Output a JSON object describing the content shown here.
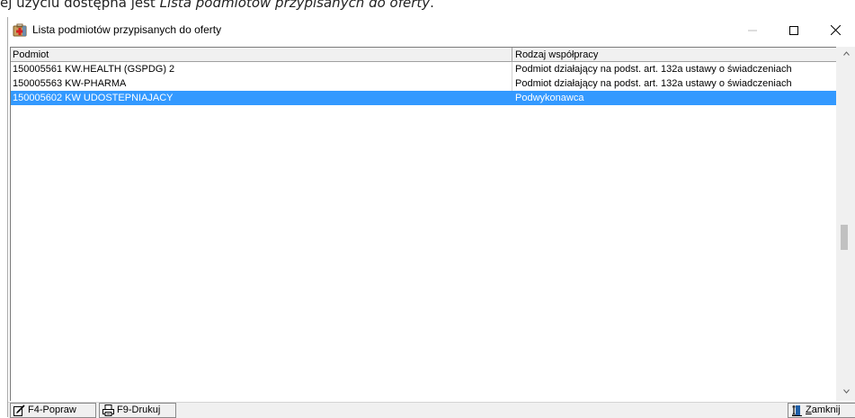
{
  "document": {
    "prefix": "ej użyciu dostępna jest ",
    "italic": "Lista podmiotów przypisanych do oferty",
    "suffix": "."
  },
  "window": {
    "title": "Lista podmiotów przypisanych do oferty"
  },
  "table": {
    "columns": [
      "Podmiot",
      "Rodzaj współpracy"
    ],
    "rows": [
      {
        "podmiot": "150005561 KW.HEALTH (GSPDG) 2",
        "rodzaj": "Podmiot działający na podst. art. 132a ustawy o świadczeniach",
        "selected": false
      },
      {
        "podmiot": "150005563 KW-PHARMA",
        "rodzaj": "Podmiot działający na podst. art. 132a ustawy o świadczeniach",
        "selected": false
      },
      {
        "podmiot": "150005602 KW UDOSTEPNIAJACY",
        "rodzaj": "Podwykonawca",
        "selected": true
      }
    ]
  },
  "footer": {
    "edit_label": "F4-Popraw",
    "print_label": "F9-Drukuj",
    "close_label_first": "Z",
    "close_label_rest": "amknij"
  },
  "colors": {
    "selection": "#3399ff",
    "header_bg": "#f0f0f0"
  }
}
